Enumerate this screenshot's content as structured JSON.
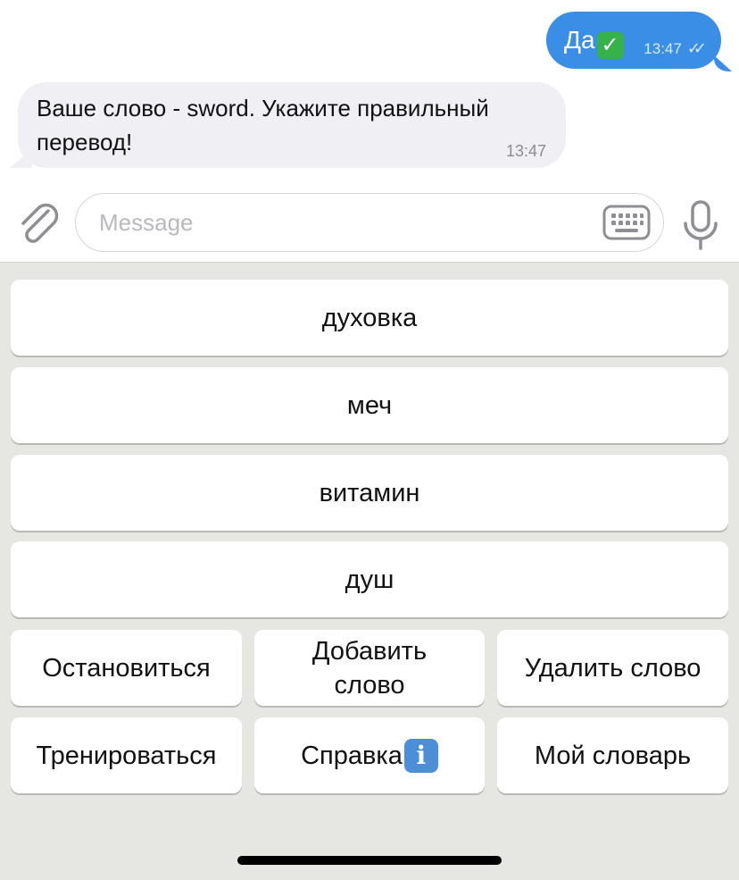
{
  "messages": {
    "outgoing": {
      "text": "Да",
      "emoji": "✓",
      "time": "13:47"
    },
    "incoming": {
      "text_line1": "Ваше слово - sword. Укажите правильный",
      "text_line2": "перевод!",
      "time": "13:47"
    }
  },
  "input": {
    "placeholder": "Message"
  },
  "keyboard": {
    "options": [
      "духовка",
      "меч",
      "витамин",
      "душ"
    ],
    "row5": [
      "Остановиться",
      "Добавить слово",
      "Удалить слово"
    ],
    "row6": [
      "Тренироваться",
      "Справка",
      "Мой словарь"
    ],
    "info_emoji": "i"
  },
  "icons": {
    "attach": "paperclip-icon",
    "keyboard": "keyboard-icon",
    "mic": "microphone-icon",
    "read": "double-check-icon"
  },
  "colors": {
    "outgoing_bubble": "#3a8ee6",
    "incoming_bubble": "#efeff4",
    "keyboard_bg": "#e6e6e3"
  }
}
